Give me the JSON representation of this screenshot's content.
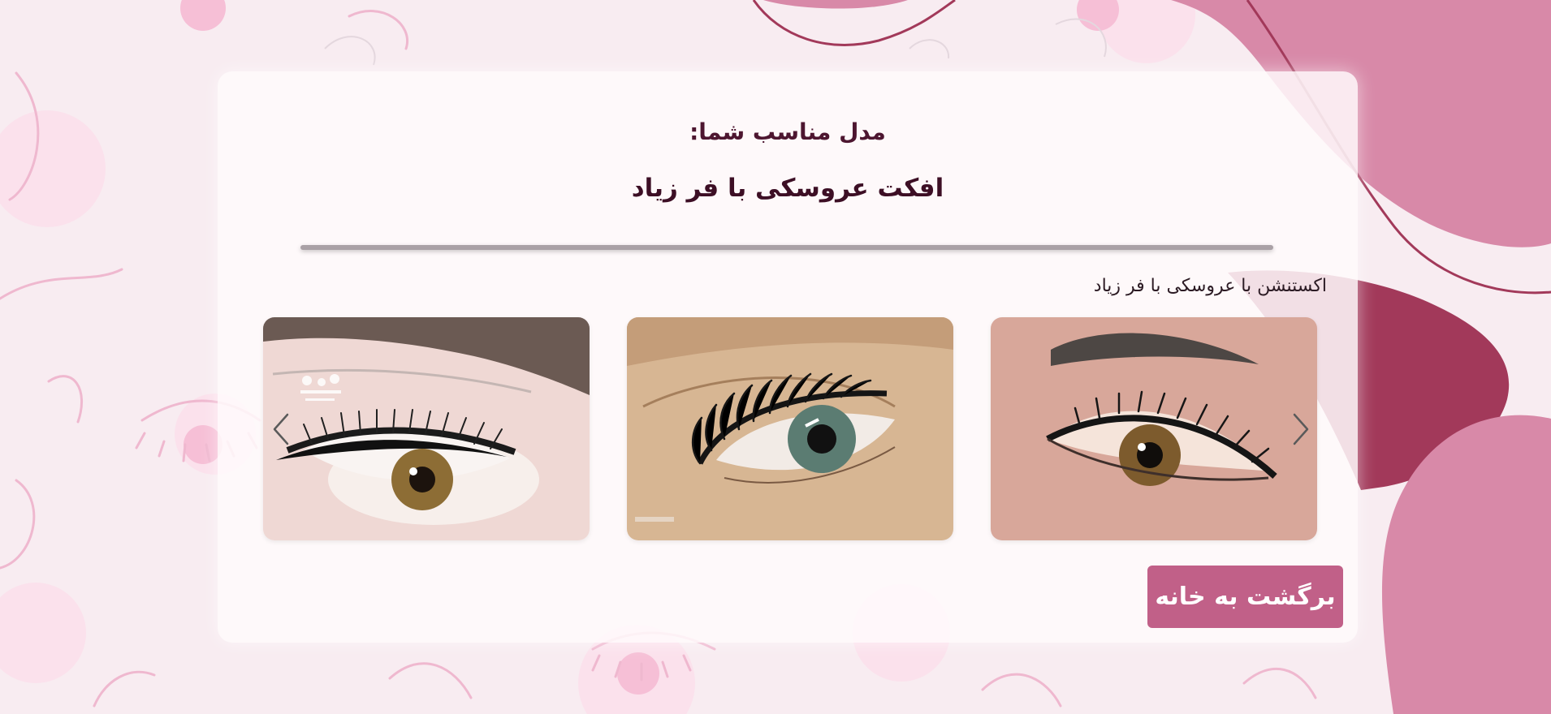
{
  "result": {
    "subtitle": "مدل مناسب شما:",
    "title": "افکت عروسکی با فر زیاد"
  },
  "carousel": {
    "active_caption": "اکستنشن با عروسکی با فر زیاد",
    "slides": [
      {
        "alt": "lash-extension-photo-1"
      },
      {
        "alt": "lash-extension-photo-2"
      },
      {
        "alt": "lash-extension-photo-3"
      }
    ],
    "prev_icon": "chevron-left-icon",
    "next_icon": "chevron-right-icon"
  },
  "actions": {
    "home_button": "برگشت به خانه"
  },
  "colors": {
    "background": "#f8ecf1",
    "accent_pink": "#d889a8",
    "accent_maroon": "#a2395a",
    "button": "#c16088",
    "title_text": "#3d0f25"
  }
}
